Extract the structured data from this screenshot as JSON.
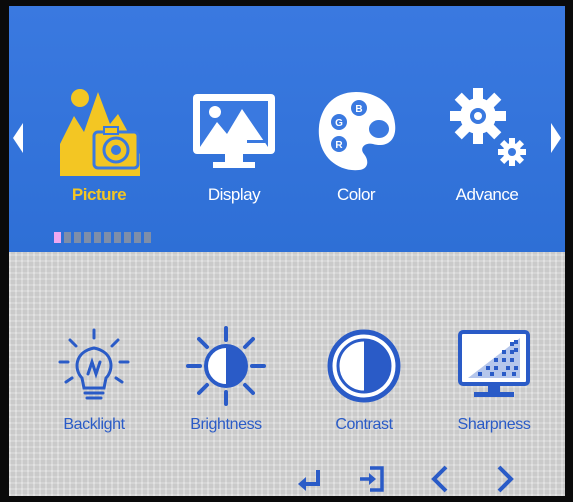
{
  "menu": {
    "items": [
      {
        "label": "Picture",
        "icon": "picture-icon",
        "active": true
      },
      {
        "label": "Display",
        "icon": "display-icon",
        "active": false
      },
      {
        "label": "Color",
        "icon": "color-palette-icon",
        "active": false
      },
      {
        "label": "Advance",
        "icon": "gear-icon",
        "active": false
      }
    ],
    "palette_letters": [
      "B",
      "G",
      "R"
    ],
    "page_indicator": {
      "total": 10,
      "current": 1
    }
  },
  "submenu": {
    "items": [
      {
        "label": "Backlight",
        "icon": "lightbulb-icon"
      },
      {
        "label": "Brightness",
        "icon": "sun-icon"
      },
      {
        "label": "Contrast",
        "icon": "contrast-icon"
      },
      {
        "label": "Sharpness",
        "icon": "sharpness-icon"
      }
    ]
  },
  "nav": {
    "buttons": [
      {
        "name": "enter-icon"
      },
      {
        "name": "exit-icon"
      },
      {
        "name": "prev-chevron-icon"
      },
      {
        "name": "next-chevron-icon"
      }
    ]
  },
  "colors": {
    "top_bg": "#3a79e0",
    "bottom_bg": "#d7d7d7",
    "active_label": "#f3c623",
    "icon_white": "#ffffff",
    "submenu_blue": "#2a5bc7"
  }
}
